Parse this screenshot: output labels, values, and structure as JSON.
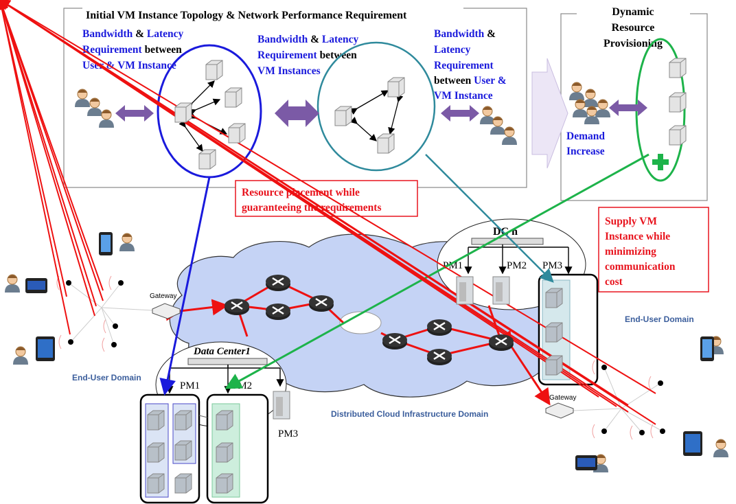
{
  "topology_box": {
    "title": "Initial VM Instance Topology & Network Performance Requirement",
    "left_req": {
      "l1a": "Bandwidth",
      "l1b": " & ",
      "l1c": "Latency",
      "l2a": "Requirement",
      "l2b": " between",
      "l3": "User & VM Instance"
    },
    "mid_req": {
      "l1a": "Bandwidth",
      "l1b": " & ",
      "l1c": "Latency",
      "l2a": "Requirement",
      "l2b": " between",
      "l3": "VM Instances"
    },
    "right_req": {
      "l1a": "Bandwidth",
      "l1b": " &",
      "l2": "Latency",
      "l3": "Requirement",
      "l4a": "between ",
      "l4b": "User &",
      "l5": "VM Instance"
    }
  },
  "provisioning_box": {
    "title_lines": [
      "Dynamic",
      "Resource",
      "Provisioning"
    ],
    "demand_lines": [
      "Demand",
      "Increase"
    ]
  },
  "callouts": {
    "placement": [
      "Resource placement while",
      "guaranteeing  the requirements"
    ],
    "supply": [
      "Supply VM",
      "Instance while",
      "minimizing",
      "communication",
      "cost"
    ]
  },
  "infrastructure": {
    "dc1_label": "Data Center1",
    "dcn_label": "DC n",
    "pm1": "PM1",
    "pm2": "PM2",
    "pm3": "PM3",
    "gateway": "Gateway",
    "end_user_domain": "End-User Domain",
    "cloud_domain": "Distributed Cloud Infrastructure Domain"
  },
  "colors": {
    "blue_text": "#1a1adc",
    "red_text": "#e8141e",
    "purple_arrow": "#7b5aa6",
    "blue_ellipse": "#1a1adc",
    "teal_ellipse": "#2f8a9c",
    "green_ellipse": "#1db34a",
    "cloud": "#c5d3f5",
    "link_red": "#ee1111"
  }
}
